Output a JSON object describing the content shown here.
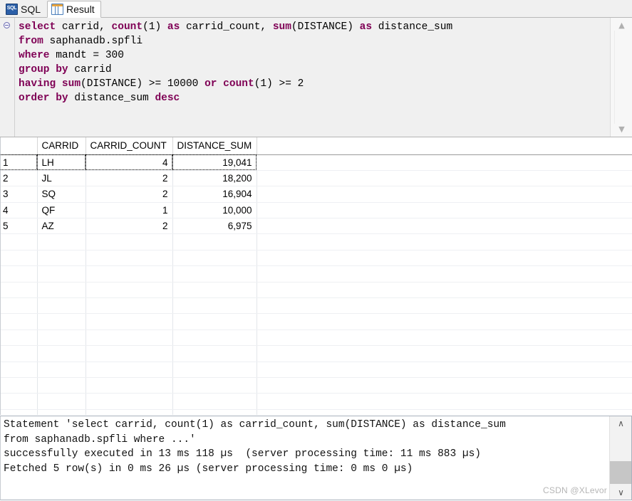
{
  "tabs": [
    {
      "label": "SQL",
      "icon": "sql-icon",
      "active": false
    },
    {
      "label": "Result",
      "icon": "result-grid-icon",
      "active": true
    }
  ],
  "editor": {
    "fold_marker": "collapse-minus-icon",
    "scrollbar": {
      "up": "▲",
      "down": "▼"
    },
    "lines": [
      [
        {
          "t": "select",
          "k": true
        },
        {
          "t": " carrid, ",
          "k": false
        },
        {
          "t": "count",
          "k": true
        },
        {
          "t": "(1) ",
          "k": false
        },
        {
          "t": "as",
          "k": true
        },
        {
          "t": " carrid_count, ",
          "k": false
        },
        {
          "t": "sum",
          "k": true
        },
        {
          "t": "(DISTANCE) ",
          "k": false
        },
        {
          "t": "as",
          "k": true
        },
        {
          "t": " distance_sum",
          "k": false
        }
      ],
      [
        {
          "t": "from",
          "k": true
        },
        {
          "t": " saphanadb.spfli",
          "k": false
        }
      ],
      [
        {
          "t": "where",
          "k": true
        },
        {
          "t": " mandt = 300",
          "k": false
        }
      ],
      [
        {
          "t": "group by",
          "k": true
        },
        {
          "t": " carrid",
          "k": false
        }
      ],
      [
        {
          "t": "having",
          "k": true
        },
        {
          "t": " ",
          "k": false
        },
        {
          "t": "sum",
          "k": true
        },
        {
          "t": "(DISTANCE) >= 10000 ",
          "k": false
        },
        {
          "t": "or",
          "k": true
        },
        {
          "t": " ",
          "k": false
        },
        {
          "t": "count",
          "k": true
        },
        {
          "t": "(1) >= 2",
          "k": false
        }
      ],
      [
        {
          "t": "order by",
          "k": true
        },
        {
          "t": " distance_sum ",
          "k": false
        },
        {
          "t": "desc",
          "k": true
        }
      ]
    ]
  },
  "result_grid": {
    "columns": [
      "",
      "CARRID",
      "CARRID_COUNT",
      "DISTANCE_SUM"
    ],
    "rows": [
      {
        "n": "1",
        "carrid": "LH",
        "carrid_count": "4",
        "distance_sum": "19,041",
        "selected": true
      },
      {
        "n": "2",
        "carrid": "JL",
        "carrid_count": "2",
        "distance_sum": "18,200",
        "selected": false
      },
      {
        "n": "3",
        "carrid": "SQ",
        "carrid_count": "2",
        "distance_sum": "16,904",
        "selected": false
      },
      {
        "n": "4",
        "carrid": "QF",
        "carrid_count": "1",
        "distance_sum": "10,000",
        "selected": false
      },
      {
        "n": "5",
        "carrid": "AZ",
        "carrid_count": "2",
        "distance_sum": "6,975",
        "selected": false
      }
    ],
    "empty_row_count": 16
  },
  "messages": {
    "text": "Statement 'select carrid, count(1) as carrid_count, sum(DISTANCE) as distance_sum\nfrom saphanadb.spfli where ...'\nsuccessfully executed in 13 ms 118 µs  (server processing time: 11 ms 883 µs)\nFetched 5 row(s) in 0 ms 26 µs (server processing time: 0 ms 0 µs)",
    "scrollbar": {
      "up": "∧",
      "down": "∨"
    }
  },
  "watermark": "CSDN @XLevor"
}
